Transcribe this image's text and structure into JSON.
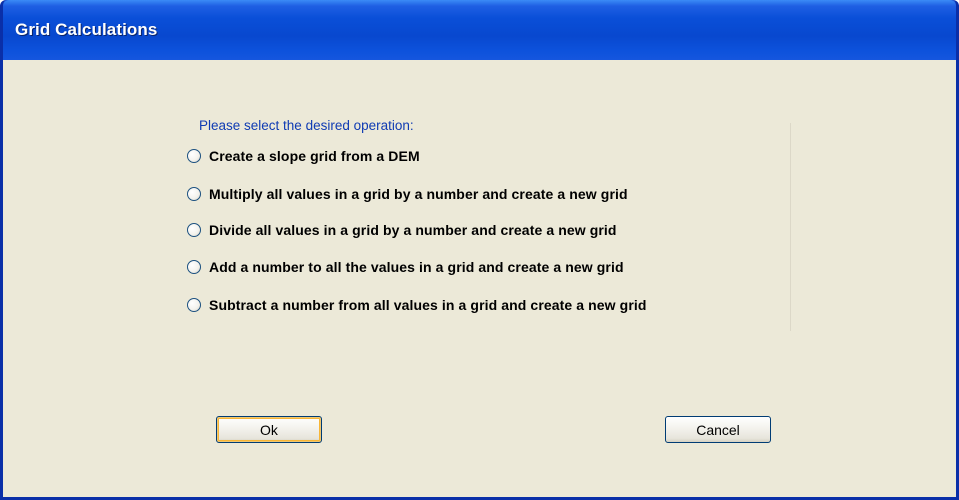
{
  "window": {
    "title": "Grid Calculations"
  },
  "dialog": {
    "prompt": "Please select the desired operation:",
    "options": [
      {
        "label": "Create a slope grid from a DEM",
        "selected": false
      },
      {
        "label": "Multiply all values in a grid by a number and create a new grid",
        "selected": false
      },
      {
        "label": "Divide all values in a grid by a number and create a new grid",
        "selected": false
      },
      {
        "label": "Add a number to all the values in a grid and create a new grid",
        "selected": false
      },
      {
        "label": "Subtract a number from all values in a grid and create a new grid",
        "selected": false
      }
    ]
  },
  "buttons": {
    "ok_label": "Ok",
    "cancel_label": "Cancel"
  },
  "colors": {
    "title_bar": "#0848cf",
    "client_background": "#ece9d8",
    "prompt_text": "#0f3bb3"
  }
}
